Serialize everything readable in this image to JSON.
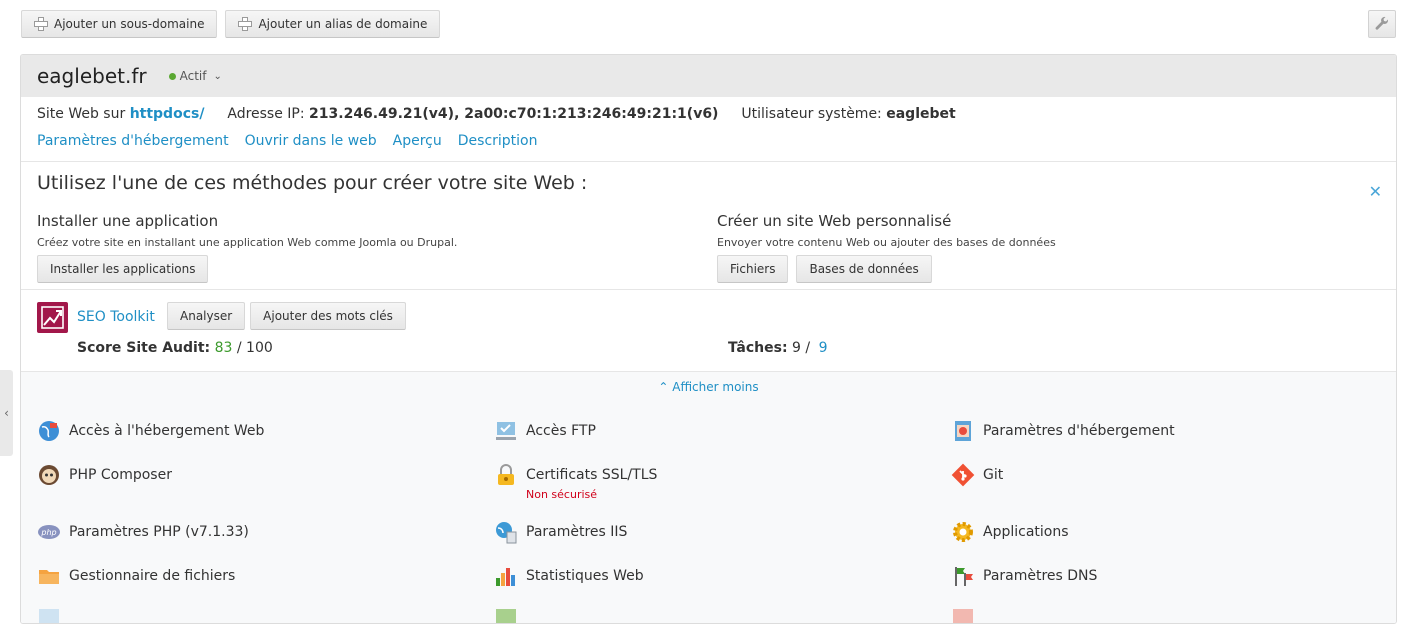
{
  "toolbar": {
    "add_subdomain": "Ajouter un sous-domaine",
    "add_alias": "Ajouter un alias de domaine"
  },
  "domain": {
    "name": "eaglebet.fr",
    "status": "Actif"
  },
  "info": {
    "site_label": "Site Web sur",
    "site_path": "httpdocs/",
    "ip_label": "Adresse IP:",
    "ip_value": "213.246.49.21(v4), 2a00:c70:1:213:246:49:21:1(v6)",
    "user_label": "Utilisateur système:",
    "user_value": "eaglebet"
  },
  "links": [
    "Paramètres d'hébergement",
    "Ouvrir dans le web",
    "Aperçu",
    "Description"
  ],
  "methods": {
    "title": "Utilisez l'une de ces méthodes pour créer votre site Web :",
    "install": {
      "title": "Installer une application",
      "desc": "Créez votre site en installant une application Web comme Joomla ou Drupal.",
      "button": "Installer les applications"
    },
    "custom": {
      "title": "Créer un site Web personnalisé",
      "desc": "Envoyer votre contenu Web ou ajouter des bases de données",
      "files_button": "Fichiers",
      "db_button": "Bases de données"
    }
  },
  "seo": {
    "title": "SEO Toolkit",
    "analyze": "Analyser",
    "add_keywords": "Ajouter des mots clés",
    "score_label": "Score Site Audit:",
    "score": "83",
    "score_max": "/ 100",
    "tasks_label": "Tâches:",
    "tasks_done": "9 /",
    "tasks_total": "9"
  },
  "show_less": "Afficher moins",
  "tools": {
    "c1r1": "Accès à l'hébergement Web",
    "c2r1": "Accès FTP",
    "c3r1": "Paramètres d'hébergement",
    "c1r2": "PHP Composer",
    "c2r2": "Certificats SSL/TLS",
    "c2r2_sub": "Non sécurisé",
    "c3r2": "Git",
    "c1r3": "Paramètres PHP (v7.1.33)",
    "c2r3": "Paramètres IIS",
    "c3r3": "Applications",
    "c1r4": "Gestionnaire de fichiers",
    "c2r4": "Statistiques Web",
    "c3r4": "Paramètres DNS"
  },
  "colors": {
    "link": "#1f8fc5",
    "status_active": "#5aa832",
    "warning": "#d0021b",
    "seo_brand": "#a2174a",
    "score": "#3c9a2c"
  }
}
